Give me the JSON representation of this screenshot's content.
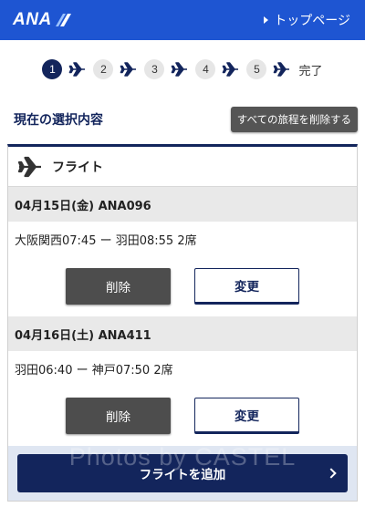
{
  "header": {
    "logo_text": "ANA",
    "top_link": "トップページ",
    "bg_color": "#1e55d2"
  },
  "steps": {
    "items": [
      "1",
      "2",
      "3",
      "4",
      "5"
    ],
    "active_index": 0,
    "done_label": "完了",
    "separator_icon": "plane-icon"
  },
  "selection": {
    "title": "現在の選択内容",
    "delete_all_label": "すべての旅程を削除する"
  },
  "panel": {
    "title": "フライト",
    "icon": "plane-icon",
    "flights": [
      {
        "header": "04月15日(金) ANA096",
        "route": "大阪関西07:45 ー 羽田08:55 2席",
        "delete_label": "削除",
        "change_label": "変更"
      },
      {
        "header": "04月16日(土) ANA411",
        "route": "羽田06:40 ー 神戸07:50 2席",
        "delete_label": "削除",
        "change_label": "変更"
      }
    ],
    "add_label": "フライトを追加"
  },
  "watermark": "Photos by CASTEL",
  "colors": {
    "navy": "#13255c",
    "delete_btn": "#4d4d4d",
    "row_header_bg": "#e9e9e9"
  }
}
